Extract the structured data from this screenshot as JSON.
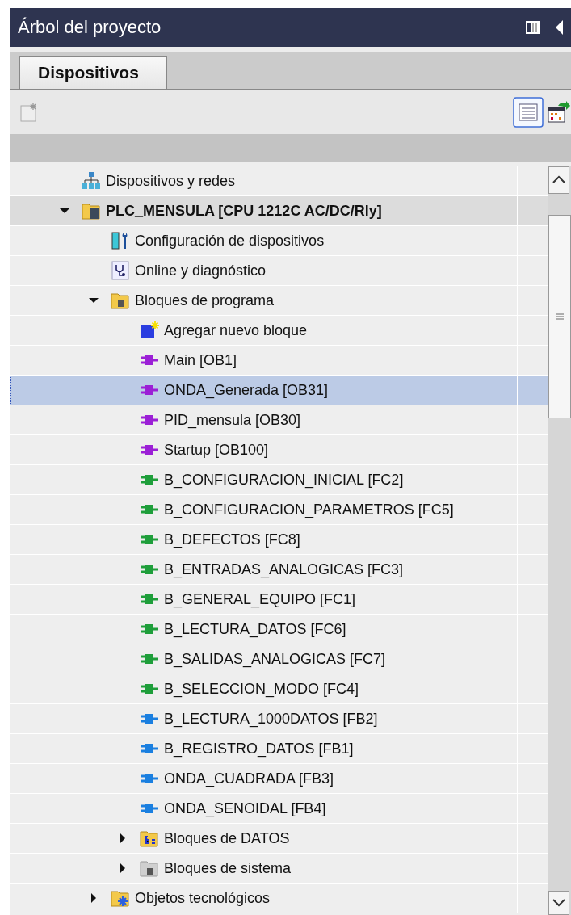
{
  "window": {
    "title": "Árbol del proyecto"
  },
  "tabs": [
    {
      "label": "Dispositivos",
      "selected": true
    }
  ],
  "tree": {
    "items": [
      {
        "label": "Dispositivos y redes",
        "kind": "network",
        "selected": false
      },
      {
        "label": "PLC_MENSULA [CPU 1212C AC/DC/Rly]",
        "kind": "device",
        "selected": false,
        "expanded": true,
        "children": [
          {
            "label": "Configuración de dispositivos",
            "kind": "config",
            "selected": false
          },
          {
            "label": "Online y diagnóstico",
            "kind": "online",
            "selected": false
          },
          {
            "label": "Bloques de programa",
            "kind": "program-folder",
            "selected": false,
            "expanded": true,
            "children": [
              {
                "label": "Agregar nuevo bloque",
                "kind": "add",
                "selected": false
              },
              {
                "label": "Main [OB1]",
                "kind": "ob",
                "selected": false
              },
              {
                "label": "ONDA_Generada [OB31]",
                "kind": "ob",
                "selected": true
              },
              {
                "label": "PID_mensula [OB30]",
                "kind": "ob",
                "selected": false
              },
              {
                "label": "Startup [OB100]",
                "kind": "ob",
                "selected": false
              },
              {
                "label": "B_CONFIGURACION_INICIAL [FC2]",
                "kind": "fc",
                "selected": false
              },
              {
                "label": "B_CONFIGURACION_PARAMETROS [FC5]",
                "kind": "fc",
                "selected": false
              },
              {
                "label": "B_DEFECTOS [FC8]",
                "kind": "fc",
                "selected": false
              },
              {
                "label": "B_ENTRADAS_ANALOGICAS [FC3]",
                "kind": "fc",
                "selected": false
              },
              {
                "label": "B_GENERAL_EQUIPO [FC1]",
                "kind": "fc",
                "selected": false
              },
              {
                "label": "B_LECTURA_DATOS [FC6]",
                "kind": "fc",
                "selected": false
              },
              {
                "label": "B_SALIDAS_ANALOGICAS [FC7]",
                "kind": "fc",
                "selected": false
              },
              {
                "label": "B_SELECCION_MODO [FC4]",
                "kind": "fc",
                "selected": false
              },
              {
                "label": "B_LECTURA_1000DATOS [FB2]",
                "kind": "fb",
                "selected": false
              },
              {
                "label": "B_REGISTRO_DATOS [FB1]",
                "kind": "fb",
                "selected": false
              },
              {
                "label": "ONDA_CUADRADA [FB3]",
                "kind": "fb",
                "selected": false
              },
              {
                "label": "ONDA_SENOIDAL [FB4]",
                "kind": "fb",
                "selected": false
              },
              {
                "label": "Bloques de DATOS",
                "kind": "data-folder",
                "selected": false,
                "expanded": false
              },
              {
                "label": "Bloques de sistema",
                "kind": "system-folder",
                "selected": false,
                "expanded": false
              }
            ]
          },
          {
            "label": "Objetos tecnológicos",
            "kind": "tech-folder",
            "selected": false,
            "expanded": false
          }
        ]
      }
    ]
  }
}
